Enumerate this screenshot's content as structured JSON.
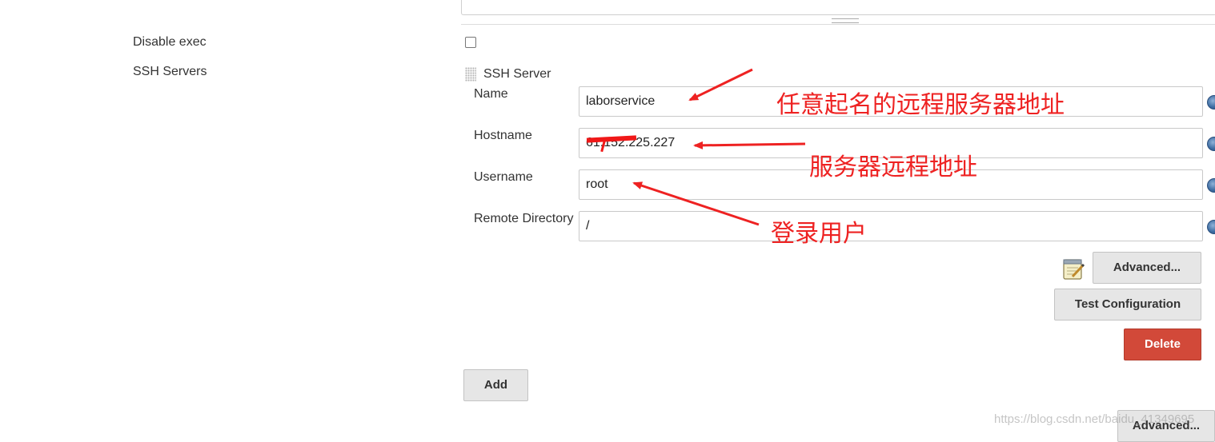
{
  "left_labels": {
    "disable_exec": "Disable exec",
    "ssh_servers": "SSH Servers"
  },
  "ssh_server": {
    "header": "SSH Server",
    "fields": {
      "name": {
        "label": "Name",
        "value": "laborservice"
      },
      "hostname": {
        "label": "Hostname",
        "value": "61.152.225.227"
      },
      "username": {
        "label": "Username",
        "value": "root"
      },
      "remote_dir": {
        "label": "Remote Directory",
        "value": "/"
      }
    },
    "buttons": {
      "advanced": "Advanced...",
      "test_configuration": "Test Configuration",
      "delete": "Delete"
    }
  },
  "add_button": "Add",
  "bottom_advanced": "Advanced...",
  "annotations": {
    "name_note": "任意起名的远程服务器地址",
    "hostname_note": "服务器远程地址",
    "username_note": "登录用户"
  },
  "watermark": "https://blog.csdn.net/baidu_41349695",
  "colors": {
    "annotation_red": "#ee2222",
    "delete_red": "#d24939",
    "button_grey": "#e6e6e6"
  },
  "icons": [
    "help-icon",
    "notepad-icon",
    "drag-handle-icon"
  ]
}
